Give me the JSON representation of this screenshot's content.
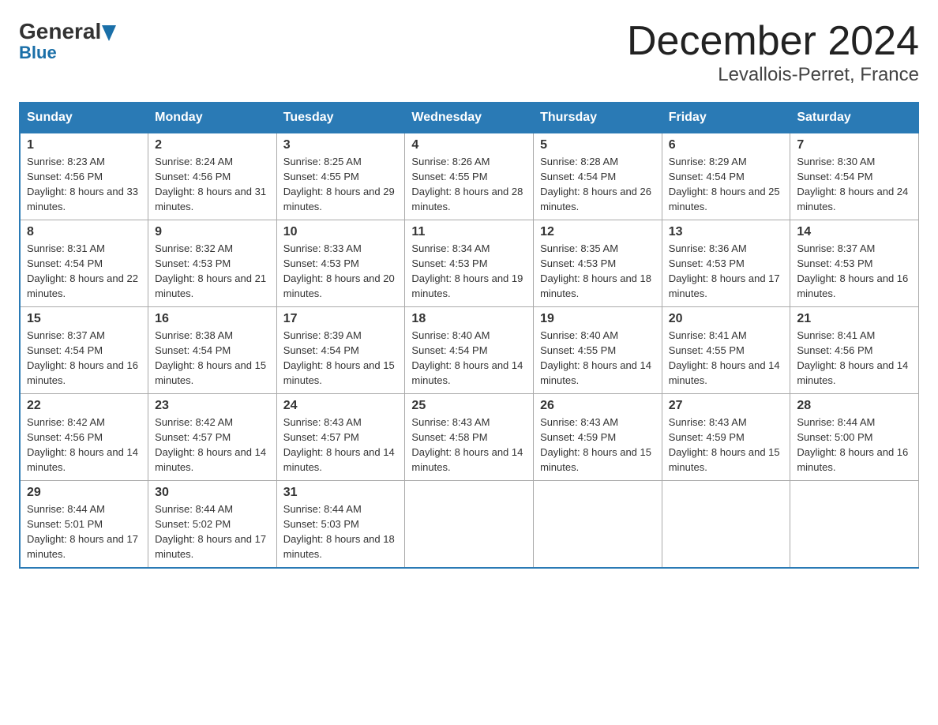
{
  "header": {
    "logo_general": "General",
    "logo_blue": "Blue",
    "month": "December 2024",
    "location": "Levallois-Perret, France"
  },
  "days_header": [
    "Sunday",
    "Monday",
    "Tuesday",
    "Wednesday",
    "Thursday",
    "Friday",
    "Saturday"
  ],
  "weeks": [
    [
      {
        "num": "1",
        "sunrise": "8:23 AM",
        "sunset": "4:56 PM",
        "daylight": "8 hours and 33 minutes."
      },
      {
        "num": "2",
        "sunrise": "8:24 AM",
        "sunset": "4:56 PM",
        "daylight": "8 hours and 31 minutes."
      },
      {
        "num": "3",
        "sunrise": "8:25 AM",
        "sunset": "4:55 PM",
        "daylight": "8 hours and 29 minutes."
      },
      {
        "num": "4",
        "sunrise": "8:26 AM",
        "sunset": "4:55 PM",
        "daylight": "8 hours and 28 minutes."
      },
      {
        "num": "5",
        "sunrise": "8:28 AM",
        "sunset": "4:54 PM",
        "daylight": "8 hours and 26 minutes."
      },
      {
        "num": "6",
        "sunrise": "8:29 AM",
        "sunset": "4:54 PM",
        "daylight": "8 hours and 25 minutes."
      },
      {
        "num": "7",
        "sunrise": "8:30 AM",
        "sunset": "4:54 PM",
        "daylight": "8 hours and 24 minutes."
      }
    ],
    [
      {
        "num": "8",
        "sunrise": "8:31 AM",
        "sunset": "4:54 PM",
        "daylight": "8 hours and 22 minutes."
      },
      {
        "num": "9",
        "sunrise": "8:32 AM",
        "sunset": "4:53 PM",
        "daylight": "8 hours and 21 minutes."
      },
      {
        "num": "10",
        "sunrise": "8:33 AM",
        "sunset": "4:53 PM",
        "daylight": "8 hours and 20 minutes."
      },
      {
        "num": "11",
        "sunrise": "8:34 AM",
        "sunset": "4:53 PM",
        "daylight": "8 hours and 19 minutes."
      },
      {
        "num": "12",
        "sunrise": "8:35 AM",
        "sunset": "4:53 PM",
        "daylight": "8 hours and 18 minutes."
      },
      {
        "num": "13",
        "sunrise": "8:36 AM",
        "sunset": "4:53 PM",
        "daylight": "8 hours and 17 minutes."
      },
      {
        "num": "14",
        "sunrise": "8:37 AM",
        "sunset": "4:53 PM",
        "daylight": "8 hours and 16 minutes."
      }
    ],
    [
      {
        "num": "15",
        "sunrise": "8:37 AM",
        "sunset": "4:54 PM",
        "daylight": "8 hours and 16 minutes."
      },
      {
        "num": "16",
        "sunrise": "8:38 AM",
        "sunset": "4:54 PM",
        "daylight": "8 hours and 15 minutes."
      },
      {
        "num": "17",
        "sunrise": "8:39 AM",
        "sunset": "4:54 PM",
        "daylight": "8 hours and 15 minutes."
      },
      {
        "num": "18",
        "sunrise": "8:40 AM",
        "sunset": "4:54 PM",
        "daylight": "8 hours and 14 minutes."
      },
      {
        "num": "19",
        "sunrise": "8:40 AM",
        "sunset": "4:55 PM",
        "daylight": "8 hours and 14 minutes."
      },
      {
        "num": "20",
        "sunrise": "8:41 AM",
        "sunset": "4:55 PM",
        "daylight": "8 hours and 14 minutes."
      },
      {
        "num": "21",
        "sunrise": "8:41 AM",
        "sunset": "4:56 PM",
        "daylight": "8 hours and 14 minutes."
      }
    ],
    [
      {
        "num": "22",
        "sunrise": "8:42 AM",
        "sunset": "4:56 PM",
        "daylight": "8 hours and 14 minutes."
      },
      {
        "num": "23",
        "sunrise": "8:42 AM",
        "sunset": "4:57 PM",
        "daylight": "8 hours and 14 minutes."
      },
      {
        "num": "24",
        "sunrise": "8:43 AM",
        "sunset": "4:57 PM",
        "daylight": "8 hours and 14 minutes."
      },
      {
        "num": "25",
        "sunrise": "8:43 AM",
        "sunset": "4:58 PM",
        "daylight": "8 hours and 14 minutes."
      },
      {
        "num": "26",
        "sunrise": "8:43 AM",
        "sunset": "4:59 PM",
        "daylight": "8 hours and 15 minutes."
      },
      {
        "num": "27",
        "sunrise": "8:43 AM",
        "sunset": "4:59 PM",
        "daylight": "8 hours and 15 minutes."
      },
      {
        "num": "28",
        "sunrise": "8:44 AM",
        "sunset": "5:00 PM",
        "daylight": "8 hours and 16 minutes."
      }
    ],
    [
      {
        "num": "29",
        "sunrise": "8:44 AM",
        "sunset": "5:01 PM",
        "daylight": "8 hours and 17 minutes."
      },
      {
        "num": "30",
        "sunrise": "8:44 AM",
        "sunset": "5:02 PM",
        "daylight": "8 hours and 17 minutes."
      },
      {
        "num": "31",
        "sunrise": "8:44 AM",
        "sunset": "5:03 PM",
        "daylight": "8 hours and 18 minutes."
      },
      {
        "num": "",
        "sunrise": "",
        "sunset": "",
        "daylight": ""
      },
      {
        "num": "",
        "sunrise": "",
        "sunset": "",
        "daylight": ""
      },
      {
        "num": "",
        "sunrise": "",
        "sunset": "",
        "daylight": ""
      },
      {
        "num": "",
        "sunrise": "",
        "sunset": "",
        "daylight": ""
      }
    ]
  ],
  "labels": {
    "sunrise_prefix": "Sunrise: ",
    "sunset_prefix": "Sunset: ",
    "daylight_prefix": "Daylight: "
  }
}
